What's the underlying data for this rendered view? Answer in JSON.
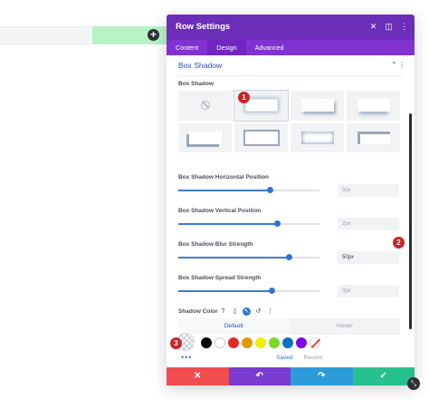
{
  "modal": {
    "title": "Row Settings",
    "header_icons": [
      "expand-icon",
      "columns-icon",
      "more-icon"
    ],
    "tabs": [
      {
        "label": "Content",
        "active": false
      },
      {
        "label": "Design",
        "active": true
      },
      {
        "label": "Advanced",
        "active": false
      }
    ]
  },
  "section": {
    "title": "Box Shadow",
    "field_label": "Box Shadow",
    "presets_selected_index": 1
  },
  "sliders": [
    {
      "label": "Box Shadow Horizontal Position",
      "value": "0px",
      "fill": 0.65
    },
    {
      "label": "Box Shadow Vertical Position",
      "value": "2px",
      "fill": 0.7
    },
    {
      "label": "Box Shadow Blur Strength",
      "value": "50px",
      "fill": 0.78
    },
    {
      "label": "Box Shadow Spread Strength",
      "value": "0px",
      "fill": 0.66
    }
  ],
  "shadow_color": {
    "label": "Shadow Color",
    "tabs": [
      {
        "label": "Default",
        "active": true
      },
      {
        "label": "Hover",
        "active": false
      }
    ],
    "swatches": [
      "#000000",
      "#ffffff",
      "#e02b20",
      "#e09900",
      "#edf000",
      "#7cda24",
      "#0c71c3",
      "#8300e9",
      "none"
    ],
    "saved_tabs": [
      {
        "label": "Saved",
        "active": true
      },
      {
        "label": "Recent",
        "active": false
      }
    ]
  },
  "footer": {
    "cancel": "✕",
    "undo": "↶",
    "redo": "↷",
    "save": "✓"
  },
  "callouts": [
    "1",
    "2",
    "3"
  ],
  "colors": {
    "header": "#6c2eb9",
    "accent": "#2f4cc6",
    "cancel": "#ef4d4f",
    "undo": "#7b3ad0",
    "redo": "#2d9bd8",
    "save": "#27c08f"
  }
}
